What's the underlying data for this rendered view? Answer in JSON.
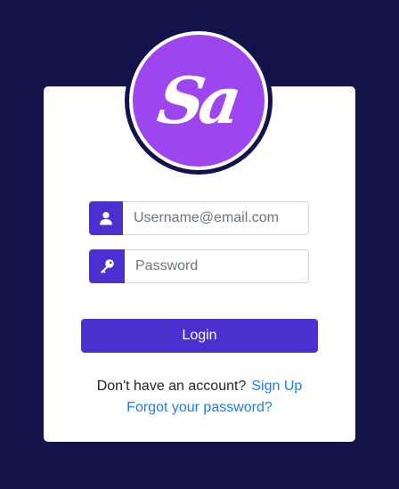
{
  "logo": {
    "text": "Sa",
    "colors": {
      "circle": "#9d45ee",
      "ring": "#14124a",
      "text": "#ffffff"
    }
  },
  "form": {
    "username": {
      "placeholder": "Username@email.com",
      "value": "",
      "icon": "user-icon"
    },
    "password": {
      "placeholder": "Password",
      "value": "",
      "icon": "key-icon"
    },
    "login_label": "Login"
  },
  "footer": {
    "signup_prompt": "Don't have an account?",
    "signup_link": "Sign Up",
    "forgot_link": "Forgot your password?"
  },
  "colors": {
    "background": "#14124a",
    "accent": "#4a30cf",
    "link": "#1a7ee6",
    "card": "#ffffff"
  }
}
